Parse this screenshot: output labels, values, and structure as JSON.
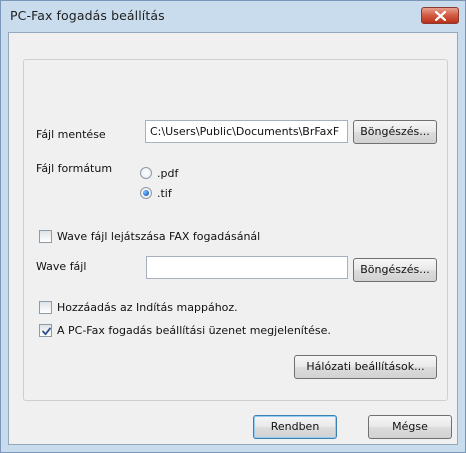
{
  "window": {
    "title": "PC-Fax fogadás beállítás"
  },
  "save_file": {
    "label": "Fájl mentése",
    "path": "C:\\Users\\Public\\Documents\\BrFaxF",
    "browse_label": "Böngészés..."
  },
  "file_format": {
    "label": "Fájl formátum",
    "options": [
      {
        "label": ".pdf",
        "selected": false
      },
      {
        "label": ".tif",
        "selected": true
      }
    ]
  },
  "wave_playback": {
    "label": "Wave fájl lejátszása FAX fogadásánál",
    "checked": false
  },
  "wave_file": {
    "label": "Wave fájl",
    "value": "",
    "browse_label": "Böngészés..."
  },
  "startup": {
    "label": "Hozzáadás az Indítás mappához.",
    "checked": false
  },
  "show_message": {
    "label": "A PC-Fax fogadás beállítási üzenet megjelenítése.",
    "checked": true
  },
  "network_settings_label": "Hálózati beállítások...",
  "ok_label": "Rendben",
  "cancel_label": "Mégse",
  "colors": {
    "title_bar": "#c9dcee",
    "client_bg": "#f0f0f0",
    "close_button": "#c7402a"
  }
}
